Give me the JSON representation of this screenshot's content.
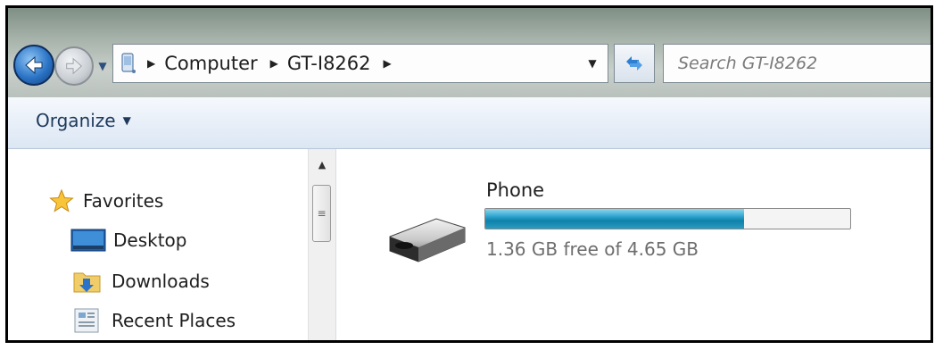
{
  "addressbar": {
    "breadcrumbs": [
      "Computer",
      "GT-I8262"
    ]
  },
  "search": {
    "placeholder": "Search GT-I8262"
  },
  "toolbar": {
    "organize_label": "Organize"
  },
  "navpane": {
    "items": [
      {
        "label": "Favorites",
        "icon": "star-icon"
      },
      {
        "label": "Desktop",
        "icon": "desktop-icon"
      },
      {
        "label": "Downloads",
        "icon": "downloads-folder-icon"
      },
      {
        "label": "Recent Places",
        "icon": "recent-places-icon"
      }
    ]
  },
  "drive": {
    "name": "Phone",
    "free_text": "1.36 GB free of 4.65 GB",
    "used_fraction": 0.71,
    "icon": "removable-drive-icon"
  },
  "colors": {
    "accent": "#1e395b",
    "bar_fill": "#1b8db7"
  }
}
